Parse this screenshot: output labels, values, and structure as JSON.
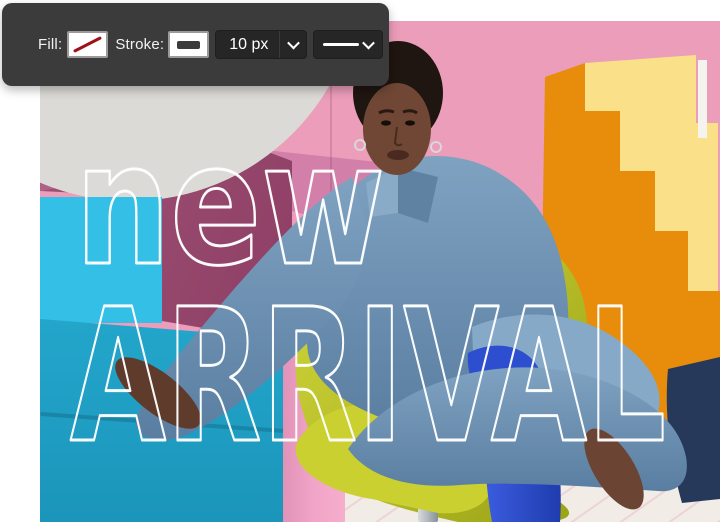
{
  "toolbar": {
    "fill": {
      "label": "Fill:",
      "swatch": "none-red-slash"
    },
    "stroke": {
      "label": "Stroke:",
      "swatch": "solid-dark-bar"
    },
    "stroke_width": {
      "value": "10 px"
    },
    "stroke_style": {
      "value": "solid-line"
    }
  },
  "canvas": {
    "overlay_text": {
      "line1": "new",
      "line2": "ARRIVAL"
    }
  },
  "palette": {
    "toolbar-bg": "#3b3b3b",
    "dropdown-bg": "#262626",
    "swatch-red": "#a01217",
    "wall-pink": "#eb9db9",
    "disc-white": "#dbdad6",
    "mauve": "#b06286",
    "wine": "#7c2d52",
    "cyan": "#33bfe6",
    "teal-a": "#27aed3",
    "teal-b": "#1b95ba",
    "pedestal-pink": "#f0a3c6",
    "stair-orange": "#e78d0b",
    "stair-yellow": "#f9e089",
    "floor": "#f1ece5",
    "chair-a": "#d3d93c",
    "chair-b": "#99a115",
    "denim-a": "#7fa2c1",
    "denim-b": "#5a7ea1",
    "boot-a": "#3b5ce0",
    "boot-b": "#1f3cae",
    "skin": "#6f4734",
    "hair": "#1f1511",
    "text-outline": "#ffffff"
  }
}
